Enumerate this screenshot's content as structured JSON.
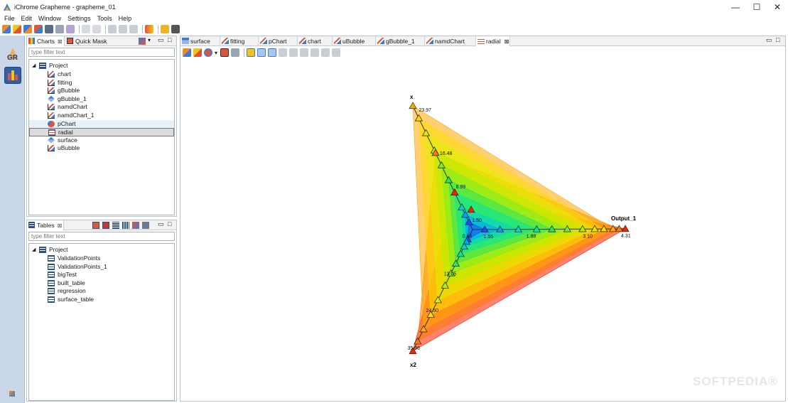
{
  "window": {
    "title": "iChrome Grapheme - grapheme_01",
    "minimize": "—",
    "maximize": "☐",
    "close": "✕"
  },
  "menu": [
    "File",
    "Edit",
    "Window",
    "Settings",
    "Tools",
    "Help"
  ],
  "toolbar_icons": [
    "new-chart-icon",
    "open-icon",
    "import-icon",
    "export-icon",
    "save-icon",
    "print-icon",
    "print-preview-icon",
    "undo-icon",
    "redo-icon",
    "cut-icon",
    "copy-icon",
    "paste-icon",
    "palette-icon",
    "run-icon",
    "video-icon"
  ],
  "charts_panel": {
    "tabs": [
      {
        "label": "Charts",
        "close": "⊠"
      },
      {
        "label": "Quick Mask",
        "close": ""
      }
    ],
    "filter_placeholder": "type filter text",
    "root": "Project",
    "items": [
      {
        "label": "chart",
        "icon": "line-chart-icon"
      },
      {
        "label": "fitting",
        "icon": "line-chart-icon"
      },
      {
        "label": "gBubble",
        "icon": "line-chart-icon"
      },
      {
        "label": "gBubble_1",
        "icon": "surface-icon"
      },
      {
        "label": "namdChart",
        "icon": "line-chart-icon"
      },
      {
        "label": "namdChart_1",
        "icon": "line-chart-icon"
      },
      {
        "label": "pChart",
        "icon": "pie-chart-icon"
      },
      {
        "label": "radial",
        "icon": "radial-chart-icon"
      },
      {
        "label": "surface",
        "icon": "surface-icon"
      },
      {
        "label": "uBubble",
        "icon": "line-chart-icon"
      }
    ],
    "selected": "radial",
    "hovered": "pChart"
  },
  "tables_panel": {
    "tab": {
      "label": "Tables",
      "close": "⊠"
    },
    "filter_placeholder": "type filter text",
    "root": "Project",
    "items": [
      "ValidationPoints",
      "ValidationPoints_1",
      "bigTest",
      "built_table",
      "regression",
      "surface_table"
    ]
  },
  "editor_tabs": [
    {
      "label": "surface",
      "icon": "surface-icon"
    },
    {
      "label": "fitting",
      "icon": "line-chart-icon"
    },
    {
      "label": "pChart",
      "icon": "line-chart-icon"
    },
    {
      "label": "chart",
      "icon": "line-chart-icon"
    },
    {
      "label": "uBubble",
      "icon": "line-chart-icon"
    },
    {
      "label": "gBubble_1",
      "icon": "line-chart-icon"
    },
    {
      "label": "namdChart",
      "icon": "line-chart-icon"
    },
    {
      "label": "radial",
      "icon": "radial-chart-icon",
      "close": "⊠"
    }
  ],
  "active_editor_tab": "radial",
  "panel_controls": {
    "minimize": "▭",
    "maximize": "□"
  },
  "chart_data": {
    "type": "radar",
    "axes": [
      {
        "name": "x",
        "ticks": [
          "23.97",
          "16.48",
          "8.99",
          "1.50"
        ],
        "max_label": "23.97"
      },
      {
        "name": "Output_1",
        "ticks": [
          "1.55",
          "1.88",
          "3.10",
          "4.31"
        ],
        "max_label": "4.31"
      },
      {
        "name": "x2",
        "ticks": [
          "0.66",
          "13.05",
          "24.50",
          "35.96"
        ],
        "max_label": "35.96"
      }
    ],
    "colormap": [
      "#1428ff",
      "#00b4ff",
      "#00dcb4",
      "#32e632",
      "#b4f000",
      "#ffdc00",
      "#ff8c00",
      "#ff1e00"
    ],
    "series": [
      {
        "values": [
          0.06,
          0.08,
          0.08
        ],
        "color": "#1a4dff"
      },
      {
        "values": [
          0.12,
          0.18,
          0.1
        ],
        "color": "#00a0ff"
      },
      {
        "values": [
          0.18,
          0.3,
          0.14
        ],
        "color": "#00d2d2"
      },
      {
        "values": [
          0.3,
          0.42,
          0.2
        ],
        "color": "#00e6a0"
      },
      {
        "values": [
          0.4,
          0.52,
          0.28
        ],
        "color": "#28e664"
      },
      {
        "values": [
          0.52,
          0.62,
          0.36
        ],
        "color": "#78ee28"
      },
      {
        "values": [
          0.64,
          0.72,
          0.46
        ],
        "color": "#b4f000"
      },
      {
        "values": [
          0.78,
          0.8,
          0.58
        ],
        "color": "#dcf000"
      },
      {
        "values": [
          0.9,
          0.86,
          0.7
        ],
        "color": "#ffdc00"
      },
      {
        "values": [
          1.0,
          0.92,
          0.82
        ],
        "color": "#ffaa00"
      },
      {
        "values": [
          0.62,
          0.96,
          0.92
        ],
        "color": "#ff7a00"
      },
      {
        "values": [
          0.3,
          1.0,
          1.0
        ],
        "color": "#ff1e00"
      }
    ]
  },
  "watermark": "SOFTPEDIA®"
}
